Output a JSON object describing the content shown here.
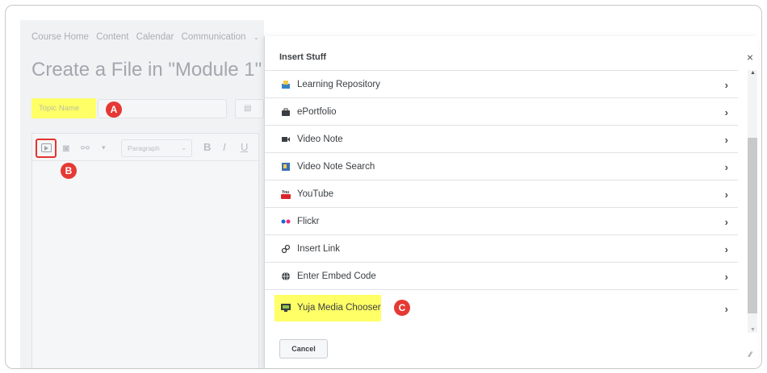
{
  "nav": {
    "items": [
      "Course Home",
      "Content",
      "Calendar",
      "Communication"
    ],
    "dropdown_glyph": "⌄"
  },
  "page": {
    "title": "Create a File in \"Module 1\"",
    "topic_placeholder": "Topic Name"
  },
  "editor": {
    "paragraph_label": "Paragraph",
    "format_buttons": [
      "B",
      "I",
      "U"
    ]
  },
  "markers": {
    "a": "A",
    "b": "B",
    "c": "C"
  },
  "dialog": {
    "title": "Insert Stuff",
    "close_glyph": "×",
    "items": [
      {
        "label": "Learning Repository",
        "icon": "repository-icon"
      },
      {
        "label": "ePortfolio",
        "icon": "briefcase-icon"
      },
      {
        "label": "Video Note",
        "icon": "video-camera-icon"
      },
      {
        "label": "Video Note Search",
        "icon": "video-search-icon"
      },
      {
        "label": "YouTube",
        "icon": "youtube-icon"
      },
      {
        "label": "Flickr",
        "icon": "flickr-icon"
      },
      {
        "label": "Insert Link",
        "icon": "link-icon"
      },
      {
        "label": "Enter Embed Code",
        "icon": "globe-icon"
      },
      {
        "label": "Yuja Media Chooser",
        "icon": "media-chooser-icon"
      }
    ],
    "arrow_glyph": "›",
    "cancel_label": "Cancel"
  },
  "colors": {
    "highlight": "#ffff66",
    "marker": "#e53935",
    "outline": "#e3342f"
  }
}
